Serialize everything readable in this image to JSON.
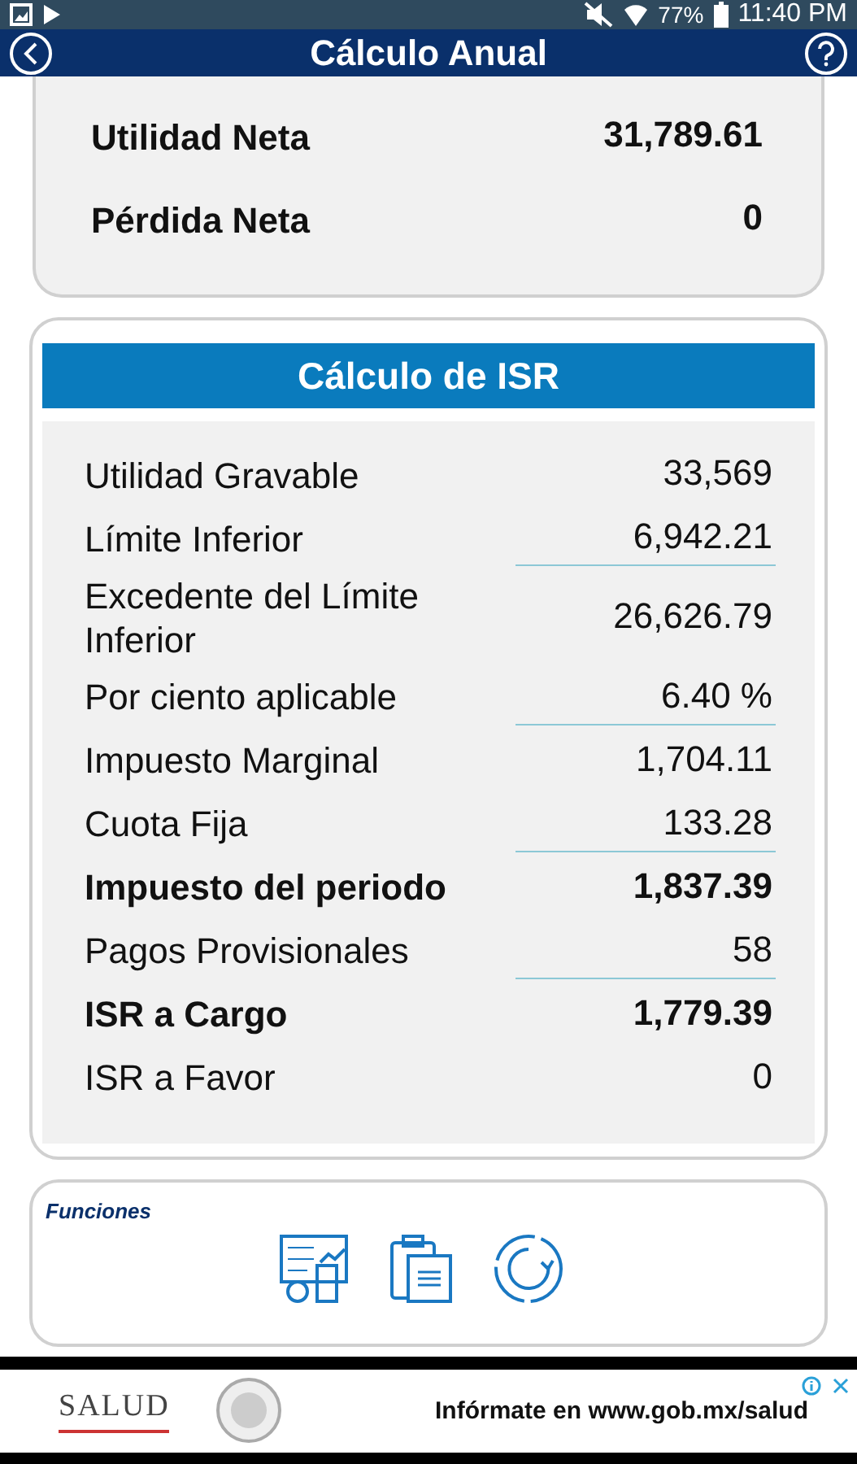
{
  "status_bar": {
    "battery": "77%",
    "time": "11:40 PM"
  },
  "header": {
    "title": "Cálculo Anual"
  },
  "summary_rows": [
    {
      "label": "Utilidad Neta",
      "value": "31,789.61"
    },
    {
      "label": "Pérdida Neta",
      "value": "0"
    }
  ],
  "isr_card": {
    "title": "Cálculo de ISR",
    "rows": [
      {
        "label": "Utilidad Gravable",
        "value": "33,569",
        "bold": false,
        "underline": false
      },
      {
        "label": "Límite Inferior",
        "value": "6,942.21",
        "bold": false,
        "underline": true
      },
      {
        "label": "Excedente del Límite Inferior",
        "value": "26,626.79",
        "bold": false,
        "underline": false
      },
      {
        "label": "Por ciento aplicable",
        "value": "6.40 %",
        "bold": false,
        "underline": true
      },
      {
        "label": "Impuesto Marginal",
        "value": "1,704.11",
        "bold": false,
        "underline": false
      },
      {
        "label": "Cuota Fija",
        "value": "133.28",
        "bold": false,
        "underline": true
      },
      {
        "label": "Impuesto del periodo",
        "value": "1,837.39",
        "bold": true,
        "underline": false
      },
      {
        "label": "Pagos Provisionales",
        "value": "58",
        "bold": false,
        "underline": true
      },
      {
        "label": "ISR a Cargo",
        "value": "1,779.39",
        "bold": true,
        "underline": false
      },
      {
        "label": "ISR a Favor",
        "value": "0",
        "bold": false,
        "underline": false
      }
    ]
  },
  "functions": {
    "title": "Funciones",
    "actions": [
      {
        "kind": "calculator"
      },
      {
        "kind": "clipboard"
      },
      {
        "kind": "refresh"
      }
    ]
  },
  "ad": {
    "logo": "SALUD",
    "text": "Infórmate en www.gob.mx/salud"
  }
}
